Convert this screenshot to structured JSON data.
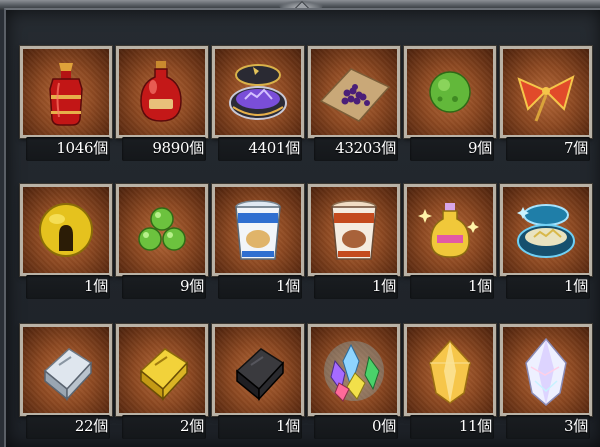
{
  "inventory": {
    "rows": [
      [
        {
          "name": "red-elixir-bottle",
          "count": "1046個"
        },
        {
          "name": "red-potion-flask",
          "count": "9890個"
        },
        {
          "name": "purple-crystal-tin",
          "count": "4401個"
        },
        {
          "name": "purple-berries-on-cloth",
          "count": "43203個"
        },
        {
          "name": "green-moss-ball",
          "count": "9個"
        },
        {
          "name": "red-gold-pinwheel",
          "count": "7個"
        }
      ],
      [
        {
          "name": "yellow-cheese-wheel",
          "count": "1個"
        },
        {
          "name": "green-dango-balls",
          "count": "9個"
        },
        {
          "name": "blue-cup-noodle",
          "count": "1個"
        },
        {
          "name": "red-cup-noodle",
          "count": "1個"
        },
        {
          "name": "sparkle-potion-bottle",
          "count": "1個"
        },
        {
          "name": "blue-crystal-tin",
          "count": "1個"
        }
      ],
      [
        {
          "name": "silver-ingot",
          "count": "22個"
        },
        {
          "name": "gold-ingot",
          "count": "2個"
        },
        {
          "name": "black-ingot",
          "count": "1個"
        },
        {
          "name": "rainbow-crystal-cluster",
          "count": "0個"
        },
        {
          "name": "amber-crystal",
          "count": "11個"
        },
        {
          "name": "clear-prism-crystal",
          "count": "3個"
        }
      ]
    ]
  },
  "colors": {
    "card_bg": "#8f4a22",
    "card_border": "#b9b2a6",
    "count_bg": "#1a1d21",
    "count_text": "#ffffff"
  }
}
